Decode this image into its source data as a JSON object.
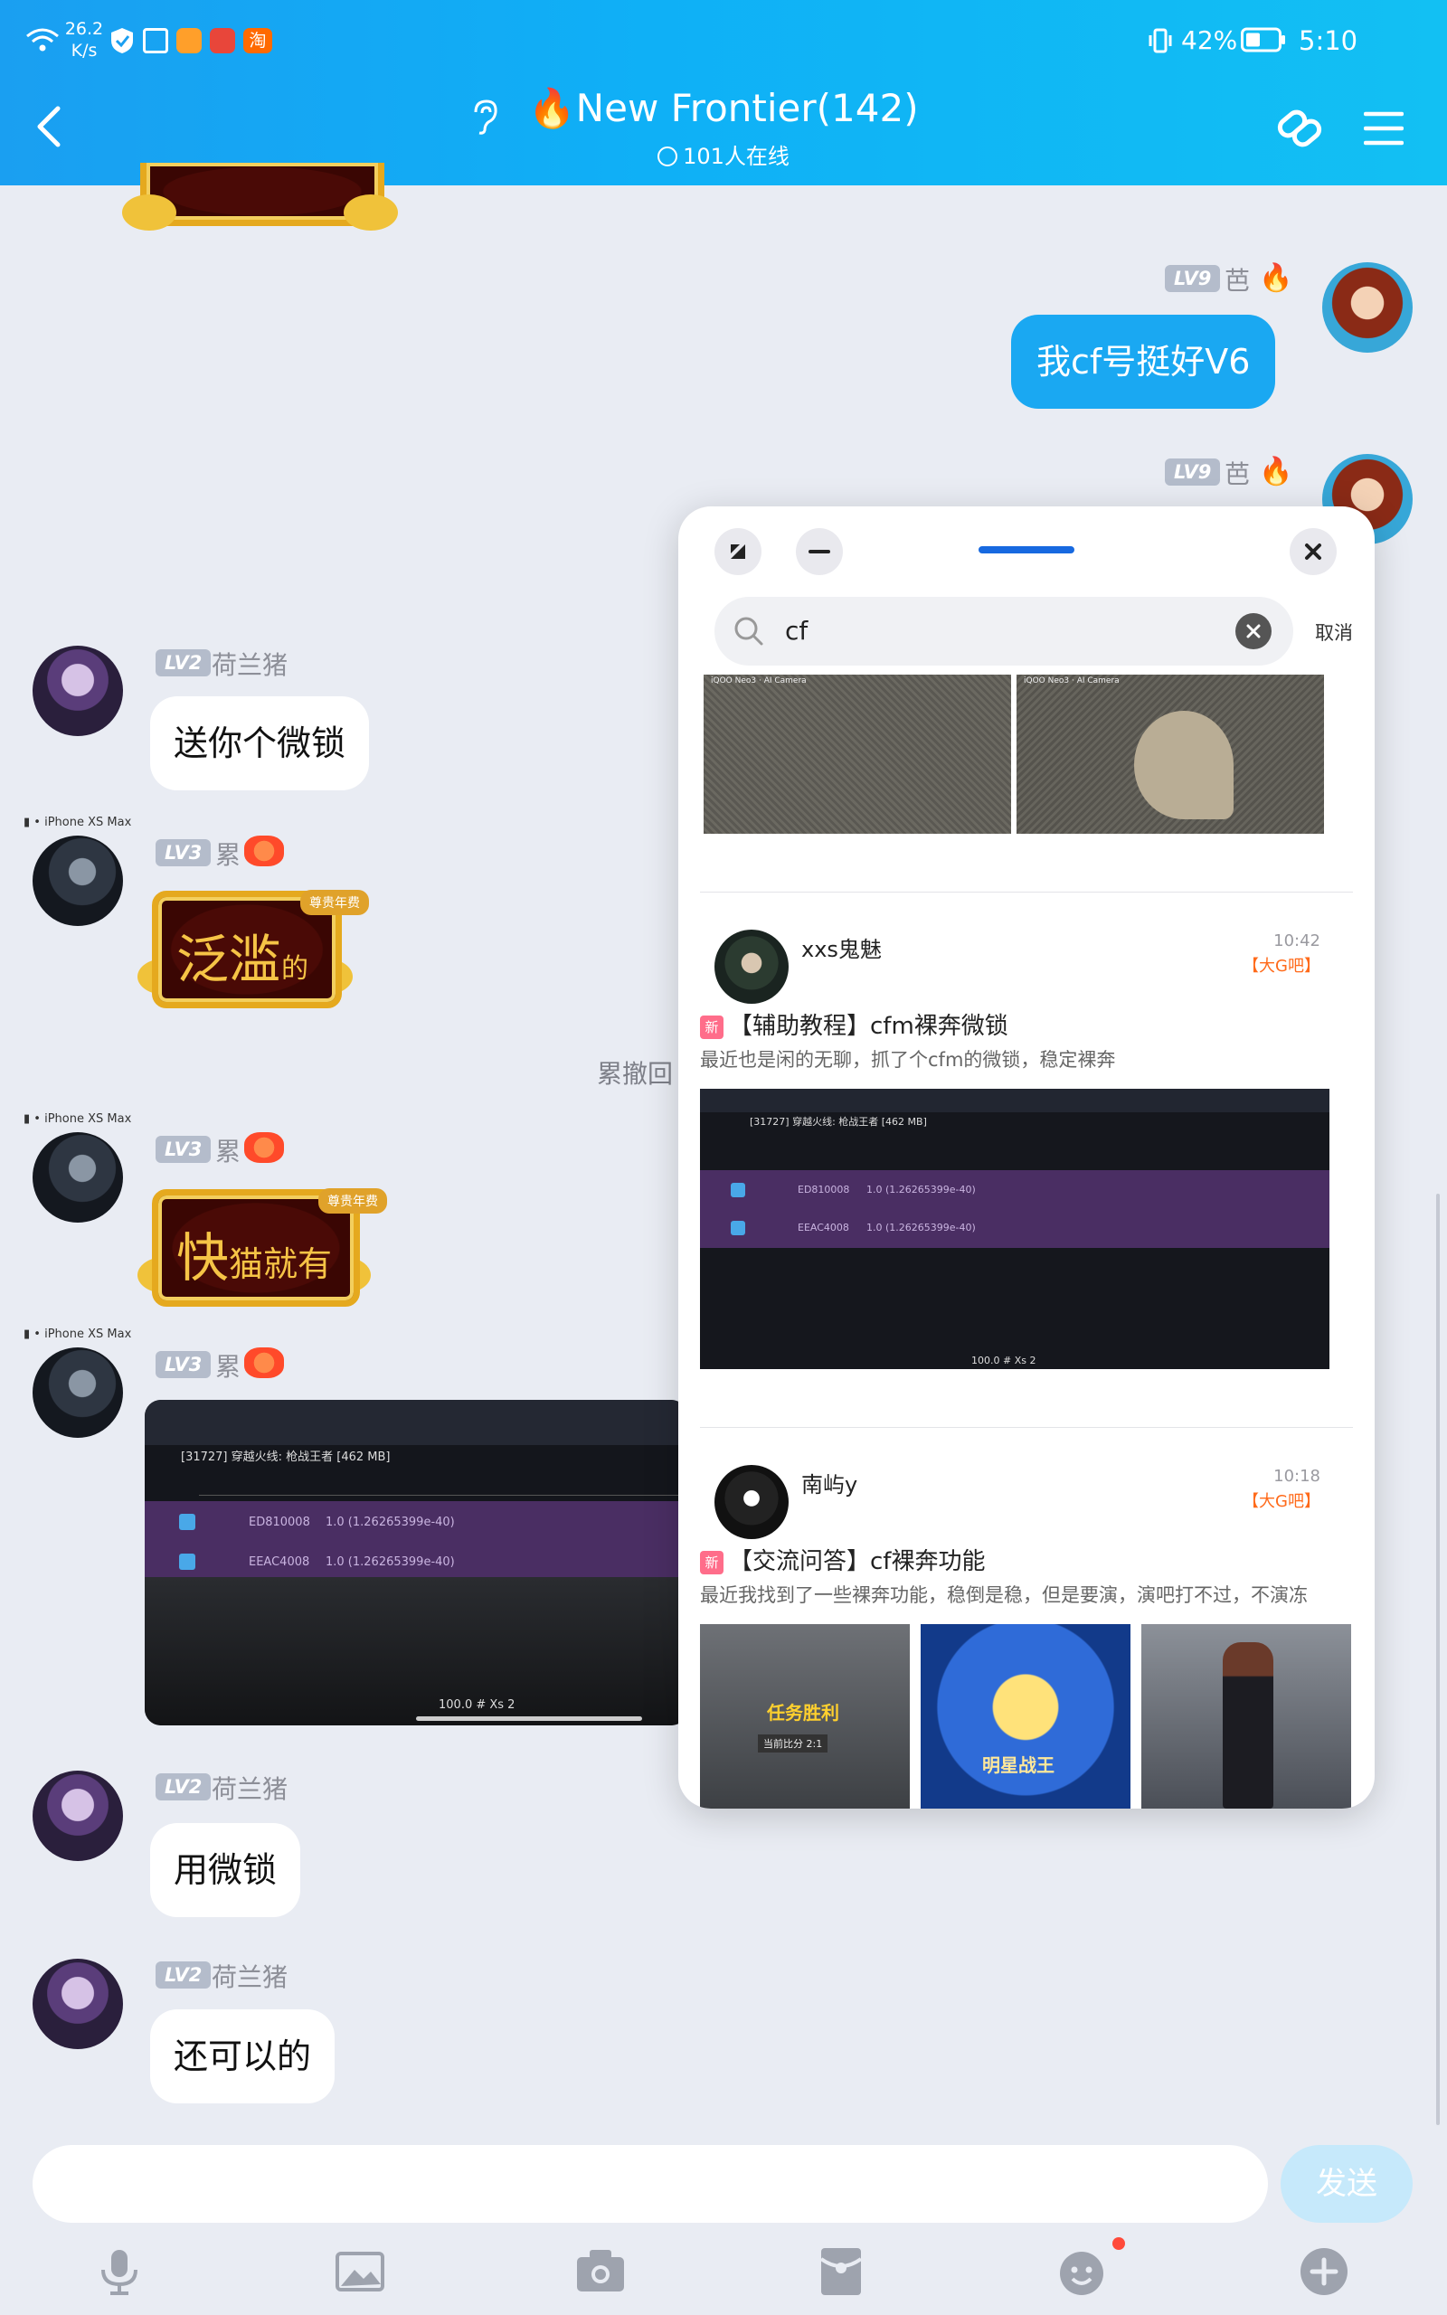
{
  "status_bar": {
    "speed_value": "26.2",
    "speed_unit": "K/s",
    "battery": "42%",
    "time": "5:10"
  },
  "header": {
    "title": "🔥New Frontier(142)",
    "online": "101人在线"
  },
  "messages": {
    "ba_name": "芭",
    "ba_lv": "LV9",
    "ba_msg1": "我cf号挺好V6",
    "pig_name": "荷兰猪",
    "pig_lv": "LV2",
    "pig_msg1": "送你个微锁",
    "pig_msg2": "用微锁",
    "pig_msg3": "还可以的",
    "lei_name": "累",
    "lei_lv": "LV3",
    "device": "iPhone XS Max",
    "sticker1_big": "泛滥",
    "sticker1_small": "的",
    "sticker2_big": "快",
    "sticker2_small": "猫就有",
    "sticker_badge": "尊贵年费",
    "recall": "累撤回"
  },
  "shot": {
    "title": "[31727] 穿越火线: 枪战王者 [462 MB]",
    "row1_addr": "ED810008",
    "row1_val": "1.0 (1.26265399e-40)",
    "row2_addr": "EEAC4008",
    "row2_val": "1.0 (1.26265399e-40)",
    "footer": "100.0 # Xs 2",
    "badge": "2"
  },
  "overlay": {
    "search_value": "cf",
    "cancel": "取消",
    "img_caption_left": "iQOO Neo3 · AI Camera",
    "img_caption_right": "iQOO Neo3 · AI Camera",
    "posts": [
      {
        "author": "xxs鬼魅",
        "time": "10:42",
        "tag": "【大G吧】",
        "new": "新",
        "title": "【辅助教程】cfm裸奔微锁",
        "desc": "最近也是闲的无聊，抓了个cfm的微锁，稳定裸奔"
      },
      {
        "author": "南屿y",
        "time": "10:18",
        "tag": "【大G吧】",
        "new": "新",
        "title": "【交流问答】cf裸奔功能",
        "desc": "最近我找到了一些裸奔功能，稳倒是稳，但是要演，演吧打不过，不演冻",
        "thumb1_text": "任务胜利",
        "thumb1_sub": "当前比分 2:1",
        "thumb2_text": "明星战王"
      }
    ]
  },
  "bottom": {
    "send": "发送"
  },
  "colors": {
    "header_blue": "#0fb0f6",
    "bubble_me": "#1aa8f2",
    "send_disabled": "#c6e9fb"
  }
}
